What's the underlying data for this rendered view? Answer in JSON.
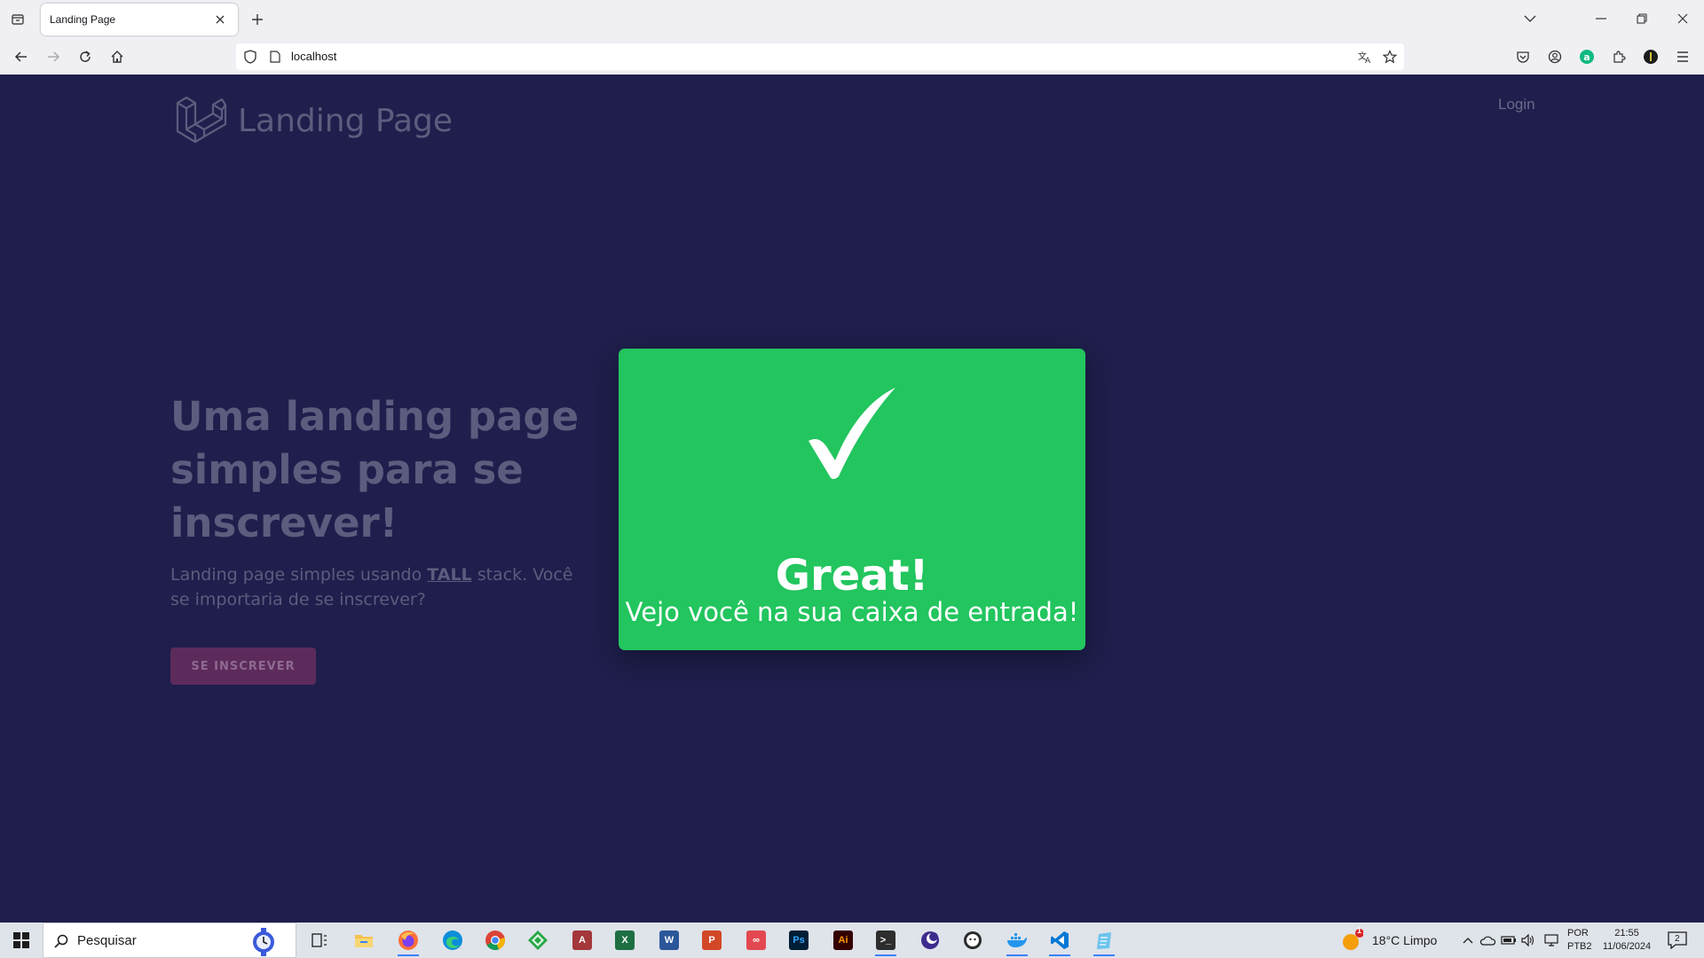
{
  "browser": {
    "tab_title": "Landing Page",
    "url": "localhost"
  },
  "page": {
    "brand_name": "Landing Page",
    "login_label": "Login",
    "headline": "Uma landing page simples para se inscrever!",
    "subtext_before": "Landing page simples usando ",
    "subtext_highlight": "TALL",
    "subtext_after": " stack. Você se importaria de se inscrever?",
    "subscribe_label": "SE INSCREVER"
  },
  "modal": {
    "check_icon": "checkmark-icon",
    "title": "Great!",
    "message": "Vejo você na sua caixa de entrada!",
    "color": "#22c55e"
  },
  "taskbar": {
    "search_placeholder": "Pesquisar",
    "weather": "18°C  Limpo",
    "weather_badge": "1",
    "lang_line1": "POR",
    "lang_line2": "PTB2",
    "time": "21:55",
    "date": "11/06/2024",
    "notifications": "2"
  },
  "colors": {
    "page_bg": "#1f1e4c",
    "muted_text": "#5d5c7e",
    "button_bg": "#5c2b5c"
  }
}
